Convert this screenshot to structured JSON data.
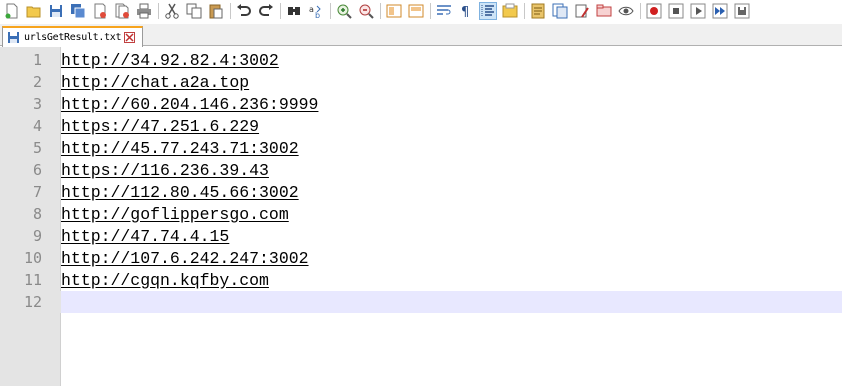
{
  "toolbar": {
    "icons": [
      "new-file-icon",
      "open-file-icon",
      "save-icon",
      "save-all-icon",
      "close-icon",
      "close-all-icon",
      "print-icon",
      "cut-icon",
      "copy-icon",
      "paste-icon",
      "undo-icon",
      "redo-icon",
      "find-icon",
      "replace-icon",
      "zoom-in-icon",
      "zoom-out-icon",
      "sync-vertical-icon",
      "sync-horizontal-icon",
      "word-wrap-icon",
      "show-all-characters-icon",
      "indent-guide-icon",
      "user-language-icon",
      "document-map-icon",
      "function-list-icon",
      "folder-workspace-icon",
      "monitoring-icon",
      "record-macro-icon",
      "stop-macro-icon",
      "play-macro-icon",
      "run-macro-multiple-icon",
      "save-macro-icon"
    ]
  },
  "tab": {
    "filename": "urlsGetResult.txt"
  },
  "editor": {
    "lines": [
      {
        "num": "1",
        "text": "http://34.92.82.4:3002"
      },
      {
        "num": "2",
        "text": "http://chat.a2a.top"
      },
      {
        "num": "3",
        "text": "http://60.204.146.236:9999"
      },
      {
        "num": "4",
        "text": "https://47.251.6.229"
      },
      {
        "num": "5",
        "text": "http://45.77.243.71:3002"
      },
      {
        "num": "6",
        "text": "https://116.236.39.43"
      },
      {
        "num": "7",
        "text": "http://112.80.45.66:3002"
      },
      {
        "num": "8",
        "text": "http://goflippersgo.com"
      },
      {
        "num": "9",
        "text": "http://47.74.4.15"
      },
      {
        "num": "10",
        "text": "http://107.6.242.247:3002"
      },
      {
        "num": "11",
        "text": "http://cgqn.kqfby.com"
      },
      {
        "num": "12",
        "text": ""
      }
    ],
    "current_line": "12"
  },
  "colors": {
    "tab_accent": "#f7a41e",
    "current_line_bg": "#e8e8ff",
    "gutter_bg": "#e4e4e4",
    "line_number": "#8a8a8a"
  }
}
